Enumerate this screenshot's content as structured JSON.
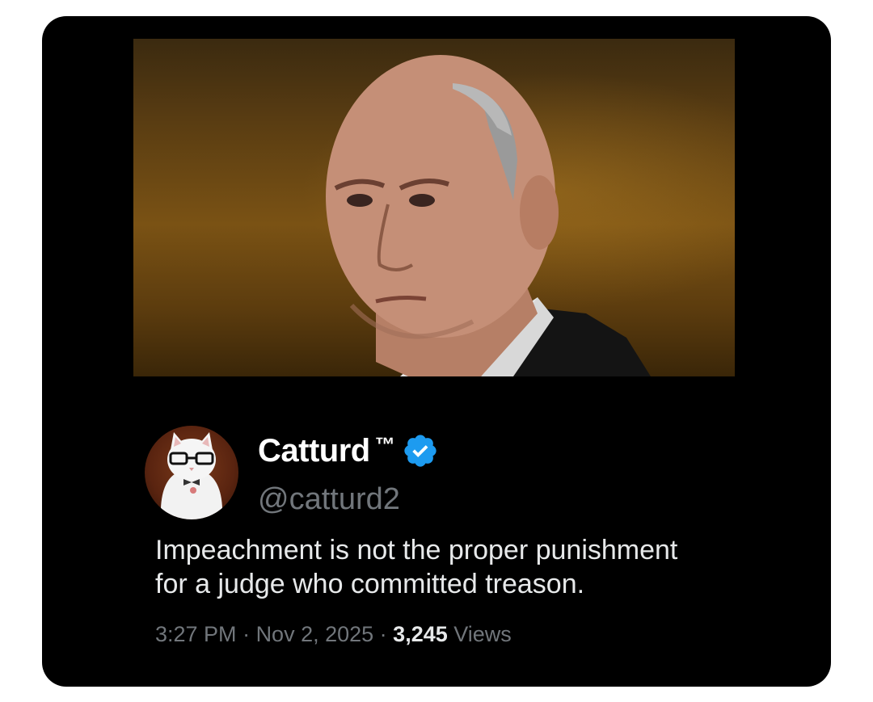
{
  "post": {
    "display_name": "Catturd",
    "trademark": "™",
    "verified_icon": "verified-badge-icon",
    "handle": "@catturd2",
    "text_line1": "Impeachment is not the proper punishment",
    "text_line2": "for a judge who committed treason.",
    "time": "3:27 PM",
    "separator": " · ",
    "date": "Nov 2, 2025",
    "views_count": "3,245",
    "views_label": "Views"
  },
  "colors": {
    "card_background": "#000000",
    "verified_blue": "#1d9bf0",
    "secondary_text": "#71767b",
    "primary_text": "#e7e9ea"
  }
}
